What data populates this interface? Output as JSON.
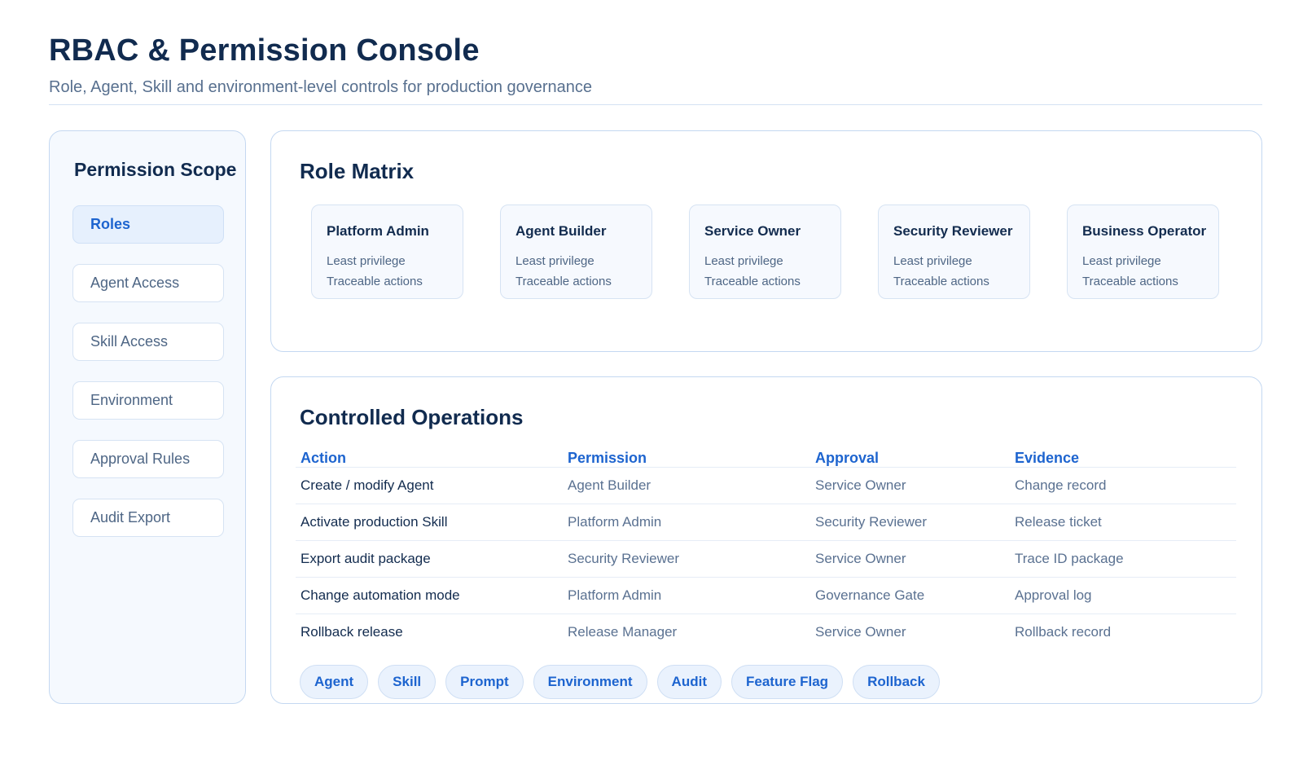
{
  "header": {
    "title": "RBAC & Permission Console",
    "subtitle": "Role, Agent, Skill and environment-level controls for production governance"
  },
  "sidebar": {
    "title": "Permission Scope",
    "items": [
      {
        "label": "Roles",
        "active": true
      },
      {
        "label": "Agent Access",
        "active": false
      },
      {
        "label": "Skill Access",
        "active": false
      },
      {
        "label": "Environment",
        "active": false
      },
      {
        "label": "Approval Rules",
        "active": false
      },
      {
        "label": "Audit Export",
        "active": false
      }
    ]
  },
  "role_matrix": {
    "title": "Role Matrix",
    "roles": [
      {
        "name": "Platform Admin",
        "traits": [
          "Least privilege",
          "Traceable actions"
        ]
      },
      {
        "name": "Agent Builder",
        "traits": [
          "Least privilege",
          "Traceable actions"
        ]
      },
      {
        "name": "Service Owner",
        "traits": [
          "Least privilege",
          "Traceable actions"
        ]
      },
      {
        "name": "Security Reviewer",
        "traits": [
          "Least privilege",
          "Traceable actions"
        ]
      },
      {
        "name": "Business Operator",
        "traits": [
          "Least privilege",
          "Traceable actions"
        ]
      }
    ]
  },
  "operations": {
    "title": "Controlled Operations",
    "columns": [
      "Action",
      "Permission",
      "Approval",
      "Evidence"
    ],
    "rows": [
      [
        "Create / modify Agent",
        "Agent Builder",
        "Service Owner",
        "Change record"
      ],
      [
        "Activate production Skill",
        "Platform Admin",
        "Security Reviewer",
        "Release ticket"
      ],
      [
        "Export audit package",
        "Security Reviewer",
        "Service Owner",
        "Trace ID package"
      ],
      [
        "Change automation mode",
        "Platform Admin",
        "Governance Gate",
        "Approval log"
      ],
      [
        "Rollback release",
        "Release Manager",
        "Service Owner",
        "Rollback record"
      ]
    ],
    "tags": [
      "Agent",
      "Skill",
      "Prompt",
      "Environment",
      "Audit",
      "Feature Flag",
      "Rollback"
    ]
  },
  "colors": {
    "accent": "#1d64cf",
    "title": "#112b4f",
    "border": "#c4d8f1",
    "muted": "#58708f"
  }
}
